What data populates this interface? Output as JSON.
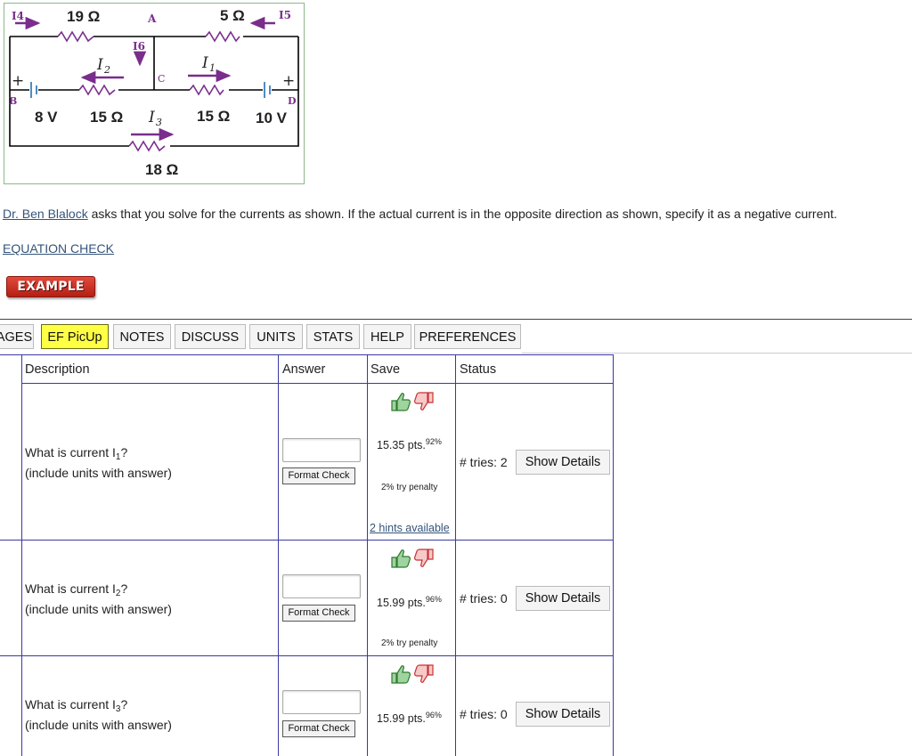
{
  "figure": {
    "labels": {
      "i4": "I4",
      "i5": "I5",
      "i6": "I6",
      "r_top_left": "19 Ω",
      "r_top_right": "5 Ω",
      "node_a": "A",
      "node_b": "B",
      "node_c": "C",
      "node_d": "D",
      "i2": "I",
      "i2_sub": "2",
      "i1": "I",
      "i1_sub": "1",
      "i3": "I",
      "i3_sub": "3",
      "v_left": "8 V",
      "v_right": "10 V",
      "r_mid_left": "15 Ω",
      "r_mid_right": "15 Ω",
      "r_bottom": "18 Ω",
      "plus": "+"
    },
    "colors": {
      "wire": "#000000",
      "current_arrow": "#7a2d8c",
      "current_label": "#7a2d8c",
      "frame": "#8cb88c"
    }
  },
  "intro": {
    "author_link": "Dr. Ben Blalock",
    "text": " asks that you solve for the currents as shown. If the actual current is in the opposite direction as shown, specify it as a negative current."
  },
  "equation_check_link": "EQUATION CHECK",
  "example_button": "EXAMPLE",
  "tabs": [
    "AGES",
    "EF PicUp",
    "NOTES",
    "DISCUSS",
    "UNITS",
    "STATS",
    "HELP",
    "PREFERENCES"
  ],
  "table": {
    "headers": [
      "Description",
      "Answer",
      "Save",
      "Status"
    ],
    "rows": [
      {
        "question_prefix": "What is current I",
        "question_sub": "1",
        "question_suffix": "?",
        "note": "(include units with answer)",
        "answer_value": "",
        "format_label": "Format Check",
        "points": "15.35 pts.",
        "percent": "92%",
        "penalty": "2% try penalty",
        "hints": "2 hints available",
        "tries": "# tries: 2",
        "details_label": "Show Details"
      },
      {
        "question_prefix": "What is current I",
        "question_sub": "2",
        "question_suffix": "?",
        "note": "(include units with answer)",
        "answer_value": "",
        "format_label": "Format Check",
        "points": "15.99 pts.",
        "percent": "96%",
        "penalty": "2% try penalty",
        "tries": "# tries: 0",
        "details_label": "Show Details"
      },
      {
        "question_prefix": "What is current I",
        "question_sub": "3",
        "question_suffix": "?",
        "note": "(include units with answer)",
        "answer_value": "",
        "format_label": "Format Check",
        "points": "15.99 pts.",
        "percent": "96%",
        "tries": "# tries: 0",
        "details_label": "Show Details"
      }
    ]
  },
  "icons": {
    "thumbs_up": "thumbs-up-icon",
    "thumbs_down": "thumbs-down-icon"
  },
  "accent_colors": {
    "tab_active": "#ffff44",
    "table_lines": "#3a3aa0",
    "link": "#34547a",
    "example": "#c8281c"
  }
}
